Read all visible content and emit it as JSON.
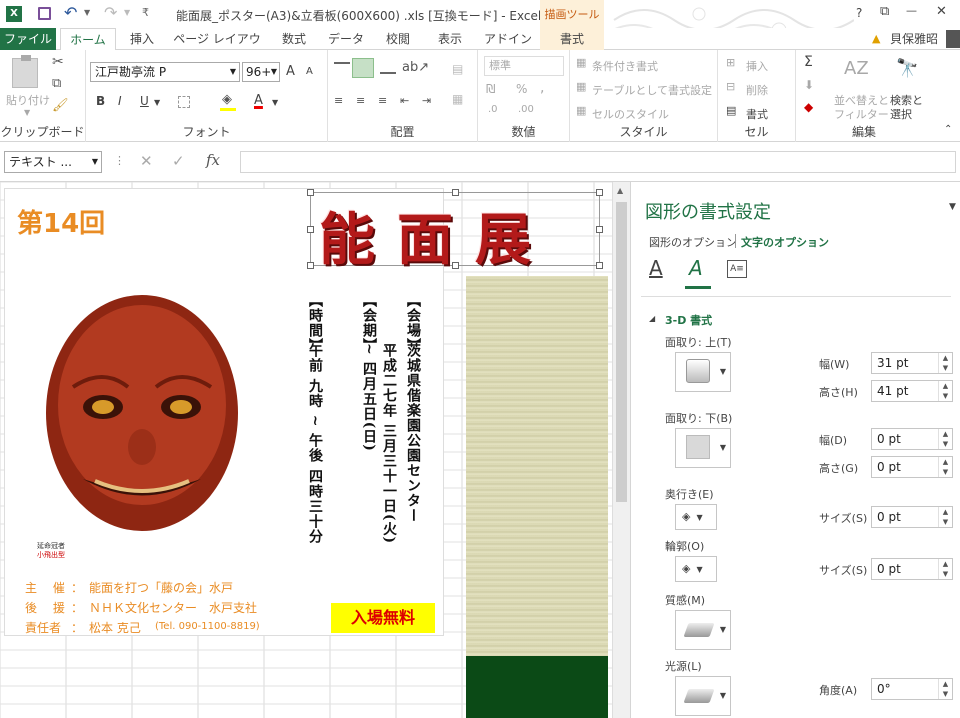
{
  "titlebar": {
    "title": "能面展_ポスター(A3)&立看板(600X600) .xls  [互換モード] - Excel",
    "context_tab": "描画ツール",
    "help": "?",
    "min": "—",
    "max": "□",
    "close": "✕",
    "restore": "⧉"
  },
  "tabs": {
    "file": "ファイル",
    "home": "ホーム",
    "insert": "挿入",
    "layout": "ページ レイアウト",
    "formula": "数式",
    "data": "データ",
    "review": "校閲",
    "view": "表示",
    "addin": "アドイン",
    "format": "書式",
    "user": "貝保雅昭"
  },
  "ribbon": {
    "clipboard": {
      "paste": "貼り付け",
      "label": "クリップボード"
    },
    "font": {
      "name": "江戸勘亭流 P",
      "size": "96+",
      "bold": "B",
      "italic": "I",
      "underline": "U",
      "grow": "A",
      "shrink": "A",
      "color_a": "A",
      "label": "フォント"
    },
    "align": {
      "label": "配置"
    },
    "number": {
      "format": "標準",
      "percent": "%",
      "comma": ",",
      "label": "数値"
    },
    "style": {
      "conditional": "条件付き書式",
      "table": "テーブルとして書式設定",
      "cell": "セルのスタイル",
      "label": "スタイル"
    },
    "cells": {
      "insert": "挿入",
      "delete": "削除",
      "format": "書式",
      "label": "セル"
    },
    "edit": {
      "sort": "並べ替えと",
      "sort2": "フィルター",
      "find": "検索と",
      "find2": "選択",
      "label": "編集"
    }
  },
  "formula": {
    "namebox": "テキスト ...",
    "fx": "fx",
    "cancel": "✕",
    "enter": "✓",
    "value": ""
  },
  "poster": {
    "edition": "第14回",
    "title": "能面展",
    "venue_label": "【会場】",
    "venue": "茨城県偕楽園公園センター",
    "period_label": "【会期】",
    "period": "平成二七年 三月三十一日(火)　~ 四月五日(日)",
    "time_label": "【時間】",
    "time": "午前 九時 ~ 午後 四時三十分",
    "caption1": "延命冠者",
    "caption2": "小飛出型",
    "sponsor_label": "主 催",
    "sponsor": "能面を打つ「藤の会」水戸",
    "support_label": "後 援",
    "support": "ＮＨＫ文化センター　水戸支社",
    "resp_label": "責任者",
    "resp": "松本 克己",
    "tel": "(Tel. 090-1100-8819)",
    "free": "入場無料",
    "colon": "："
  },
  "pane": {
    "title": "図形の書式設定",
    "tab_shape": "図形のオプション",
    "tab_text": "文字のオプション",
    "section": "3-D 書式",
    "bevel_top": "面取り: 上(T)",
    "bevel_bottom": "面取り: 下(B)",
    "depth": "奥行き(E)",
    "contour": "輪郭(O)",
    "material": "質感(M)",
    "lighting": "光源(L)",
    "width_label": "幅(W)",
    "height_label": "高さ(H)",
    "width2_label": "幅(D)",
    "height2_label": "高さ(G)",
    "size_label": "サイズ(S)",
    "size2_label": "サイズ(S)",
    "angle_label": "角度(A)",
    "width": "31 pt",
    "height": "41 pt",
    "width2": "0 pt",
    "height2": "0 pt",
    "size": "0 pt",
    "size2": "0 pt",
    "angle": "0°"
  },
  "colors": {
    "excel_green": "#217346",
    "accent_orange": "#e98c24",
    "title_red": "#b31a1a",
    "yellow": "#ffff00"
  }
}
